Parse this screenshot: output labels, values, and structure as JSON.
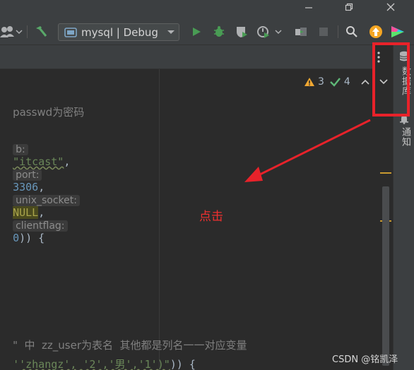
{
  "toolbar": {
    "run_config_label": "mysql | Debug"
  },
  "inspection": {
    "warnings": "3",
    "weak_warnings": "4"
  },
  "code": {
    "line1": "passwd为密码",
    "line2_hint_db": "b:",
    "line2_db_value": "\"itcast\"",
    "line2_hint_port": "port:",
    "line2_port_value": "3306",
    "line2_hint_socket": "unix_socket:",
    "line2_socket_value": "NULL",
    "line2_hint_flag": "clientflag:",
    "line2_flag_value": "0",
    "line2_tail": ")) {",
    "line3": "\"  中  zz_user为表名  其他都是列名一一对应变量",
    "line4_str": "'zhangz', '2','男','1')\"",
    "line4_tail": ")) {"
  },
  "right_panel": {
    "database_label": "数据库",
    "notifications_label": "通知"
  },
  "annotation": {
    "text": "点击"
  },
  "watermark": "CSDN @铭凯泽",
  "colors": {
    "annotation_red": "#e8222a",
    "run_green": "#499c54",
    "editor_bg": "#2b2b2b",
    "chrome_bg": "#3c3f41"
  }
}
